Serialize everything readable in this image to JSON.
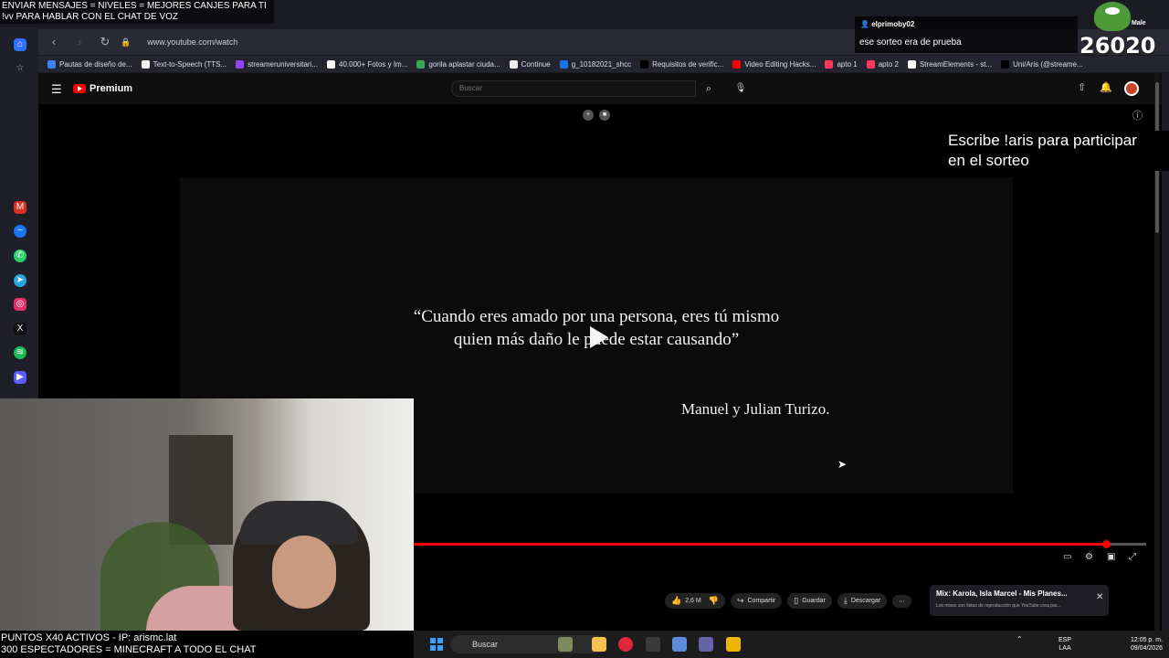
{
  "browser": {
    "url": "www.youtube.com/watch",
    "bookmarks": [
      {
        "label": "Pautas de diseño de...",
        "color": "#3b82f6"
      },
      {
        "label": "Text-to-Speech (TTS...",
        "color": "#eeeeee"
      },
      {
        "label": "streameruniversitari...",
        "color": "#9146ff"
      },
      {
        "label": "40.000+ Fotos y Im...",
        "color": "#ffffff"
      },
      {
        "label": "gorila aplastar ciuda...",
        "color": "#34a853"
      },
      {
        "label": "Continue",
        "color": "#eeeeee"
      },
      {
        "label": "g_10182021_shcc",
        "color": "#1a73e8"
      },
      {
        "label": "Requisitos de verific...",
        "color": "#000000"
      },
      {
        "label": "Video Editing Hacks...",
        "color": "#ff0000"
      },
      {
        "label": "apto 1",
        "color": "#ff385c"
      },
      {
        "label": "apto 2",
        "color": "#ff385c"
      },
      {
        "label": "StreamElements - st...",
        "color": "#ffffff"
      },
      {
        "label": "Uni/Aris (@streame...",
        "color": "#000000"
      }
    ]
  },
  "sidebar": {
    "icons": [
      "home-icon",
      "star-icon",
      "gmail-icon",
      "messenger-icon",
      "whatsapp-icon",
      "telegram-icon",
      "instagram-icon",
      "x-icon",
      "spotify-icon",
      "player-icon"
    ]
  },
  "youtube": {
    "brand": "Premium",
    "search_placeholder": "Buscar",
    "video": {
      "quote_line1": "“Cuando eres amado por una persona, eres tú mismo",
      "quote_line2": "quien más daño le puede estar causando”",
      "author": "Manuel y Julian Turizo.",
      "progress_fraction": 0.945
    },
    "actions": {
      "likes": "2,6 M",
      "share": "Compartir",
      "save": "Guardar",
      "download": "Descargar"
    },
    "mix": {
      "title": "Mix: Karola, Isla Marcel - Mis Planes...",
      "subtitle": "Los mixes son listas de reproducción que YouTube crea par..."
    }
  },
  "overlay": {
    "top_line1": "ENVIAR MENSAJES = NIVELES = MEJORES CANJES PARA TI",
    "top_line2": "!vv PARA HABLAR CON EL CHAT DE VOZ",
    "bottom_line1": "PUNTOS X40 ACTIVOS - IP: arismc.lat",
    "bottom_line2": "300 ESPECTADORES = MINECRAFT A TODO EL CHAT",
    "chat_user": "elprimoby02",
    "chat_message": "ese sorteo era de prueba",
    "counter": "26020",
    "mute_label": "Male",
    "raffle_line1": "Escribe !aris para participar",
    "raffle_line2": "en el sorteo"
  },
  "taskbar": {
    "search": "Buscar",
    "lang_line1": "ESP",
    "lang_line2": "LAA",
    "time": "12:05 p. m.",
    "date": "09/04/2026"
  }
}
